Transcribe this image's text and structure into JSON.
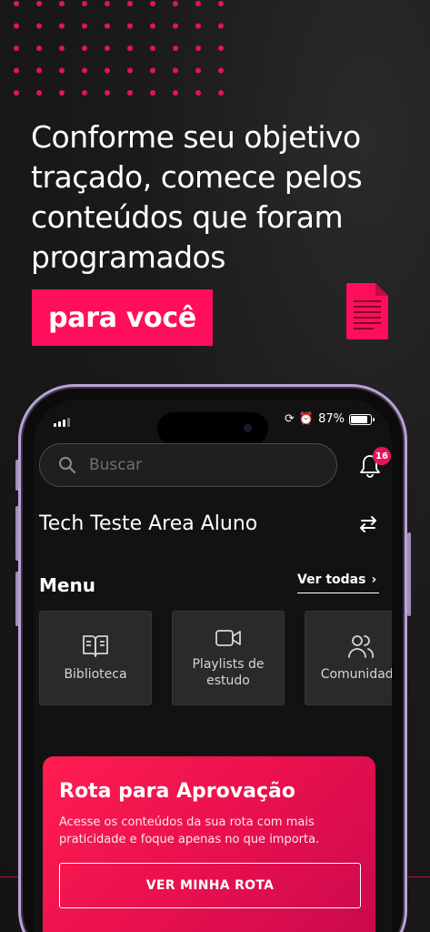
{
  "promo": {
    "headline": "Conforme seu objetivo traçado, comece pelos conteúdos que foram programados",
    "highlight": "para você",
    "accent_color": "#ff0f5b"
  },
  "status_bar": {
    "battery_percent": "87%"
  },
  "search": {
    "placeholder": "Buscar"
  },
  "notifications": {
    "count": "16"
  },
  "org": {
    "title": "Tech Teste Area Aluno"
  },
  "menu": {
    "title": "Menu",
    "see_all": "Ver todas",
    "items": [
      {
        "label": "Biblioteca",
        "icon": "book-open-icon"
      },
      {
        "label": "Playlists de estudo",
        "icon": "video-camera-icon"
      },
      {
        "label": "Comunidade",
        "icon": "users-icon"
      }
    ]
  },
  "route": {
    "title": "Rota para Aprovação",
    "description": "Acesse os conteúdos da sua rota com mais praticidade e foque apenas no que importa.",
    "button": "VER MINHA ROTA"
  }
}
